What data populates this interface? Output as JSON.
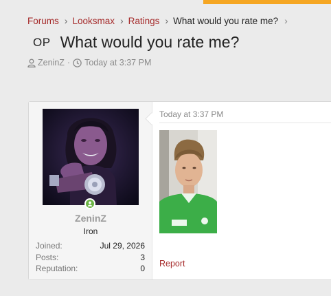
{
  "breadcrumb": {
    "items": [
      "Forums",
      "Looksmax",
      "Ratings"
    ],
    "current": "What would you rate me?"
  },
  "thread": {
    "op_badge": "OP",
    "title": "What would you rate me?",
    "author": "ZeninZ",
    "separator": "·",
    "time": "Today at 3:37 PM"
  },
  "post": {
    "time": "Today at 3:37 PM",
    "report_label": "Report"
  },
  "user": {
    "name": "ZeninZ",
    "title": "Iron",
    "stats": [
      {
        "label": "Joined:",
        "value": "Jul 29, 2026"
      },
      {
        "label": "Posts:",
        "value": "3"
      },
      {
        "label": "Reputation:",
        "value": "0"
      }
    ]
  },
  "icons": {
    "breadcrumb_separator": "chevron-right-icon",
    "author": "user-icon",
    "time": "clock-icon",
    "online": "online-status-icon"
  },
  "colors": {
    "link": "#a52a2a",
    "accent": "#f5a623",
    "online": "#6bb344"
  }
}
